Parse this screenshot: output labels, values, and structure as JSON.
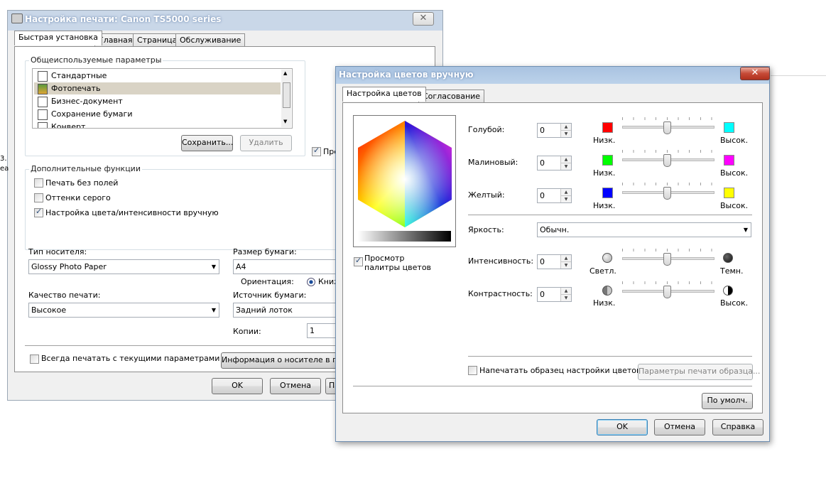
{
  "back": {
    "title": "Настройка печати: Canon TS5000 series",
    "close": "✕",
    "tabs": [
      "Быстрая установка",
      "Главная",
      "Страница",
      "Обслуживание"
    ],
    "common_group": "Общеиспользуемые параметры",
    "presets": [
      "Стандартные",
      "Фотопечать",
      "Бизнес-документ",
      "Сохранение бумаги",
      "Конверт"
    ],
    "save_btn": "Сохранить...",
    "delete_btn": "Удалить",
    "preview_check": "Пре",
    "extra_group": "Дополнительные функции",
    "options": [
      "Печать без полей",
      "Оттенки серого",
      "Настройка цвета/интенсивности вручную"
    ],
    "media_label": "Тип носителя:",
    "media_value": "Glossy Photo Paper",
    "paper_label": "Размер бумаги:",
    "paper_value": "A4",
    "orient_label": "Ориентация:",
    "orient_value": "Книж",
    "quality_label": "Качество печати:",
    "quality_value": "Высокое",
    "source_label": "Источник бумаги:",
    "source_value": "Задний лоток",
    "copies_label": "Копии:",
    "copies_value": "1",
    "always_check": "Всегда печатать с текущими параметрами",
    "media_info_btn": "Информация о носителе в при",
    "ok": "OK",
    "cancel": "Отмена",
    "apply": "П",
    "edge_texts": [
      "3.",
      "еа"
    ]
  },
  "front": {
    "title": "Настройка цветов вручную",
    "close": "✕",
    "tabs": [
      "Настройка цветов",
      "Согласование"
    ],
    "preview_check": "Просмотр палитры цветов",
    "rows": [
      {
        "label": "Голубой:",
        "value": "0",
        "low": "Низк.",
        "high": "Высок.",
        "low_color": "#ff0000",
        "high_color": "#00ffff"
      },
      {
        "label": "Малиновый:",
        "value": "0",
        "low": "Низк.",
        "high": "Высок.",
        "low_color": "#00ff00",
        "high_color": "#ff00ff"
      },
      {
        "label": "Желтый:",
        "value": "0",
        "low": "Низк.",
        "high": "Высок.",
        "low_color": "#0000ff",
        "high_color": "#ffff00"
      }
    ],
    "brightness_label": "Яркость:",
    "brightness_value": "Обычн.",
    "intensity": {
      "label": "Интенсивность:",
      "value": "0",
      "low": "Светл.",
      "high": "Темн."
    },
    "contrast": {
      "label": "Контрастность:",
      "value": "0",
      "low": "Низк.",
      "high": "Высок."
    },
    "print_sample_check": "Напечатать образец настройки цветов",
    "sample_params_btn": "Параметры печати образца...",
    "defaults_btn": "По умолч.",
    "ok": "OK",
    "cancel": "Отмена",
    "help": "Справка"
  }
}
